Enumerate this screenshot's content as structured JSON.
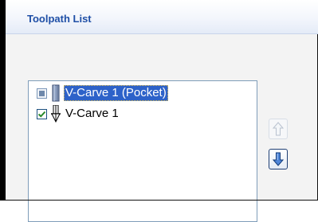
{
  "panel": {
    "title": "Toolpath List"
  },
  "toolpaths": [
    {
      "label": "V-Carve 1 (Pocket)",
      "checked": true,
      "selected": true,
      "icon": "pocket-tool-icon"
    },
    {
      "label": "V-Carve 1",
      "checked": true,
      "selected": false,
      "icon": "v-bit-tool-icon"
    }
  ],
  "controls": {
    "move_up": {
      "icon": "arrow-up-icon",
      "enabled": false
    },
    "move_down": {
      "icon": "arrow-down-icon",
      "enabled": true
    }
  },
  "colors": {
    "title": "#1f4fa6",
    "selection": "#2d62c9",
    "check": "#2a8a2a",
    "arrow_active": "#1f5fbf",
    "arrow_disabled": "#b9c2cf"
  }
}
